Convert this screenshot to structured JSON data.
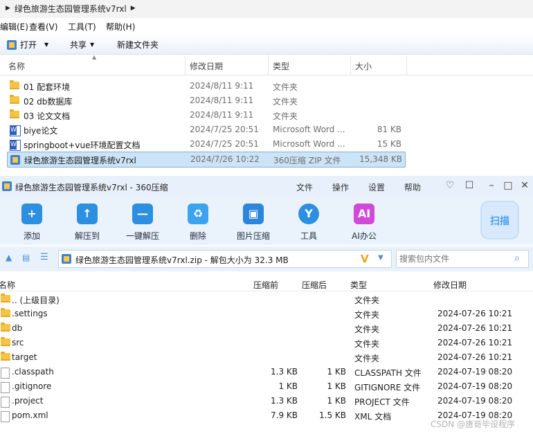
{
  "explorer": {
    "breadcrumb": "绿色旅游生态园管理系统v7rxl",
    "menu": [
      "编辑(E)",
      "查看(V)",
      "工具(T)",
      "帮助(H)"
    ],
    "toolbar": {
      "open": "打开",
      "share": "共享",
      "new_folder": "新建文件夹"
    },
    "columns": {
      "name": "名称",
      "date": "修改日期",
      "type": "类型",
      "size": "大小"
    },
    "rows": [
      {
        "icon": "folder-icon",
        "name": "01 配套环境",
        "date": "2024/8/11 9:11",
        "type": "文件夹",
        "size": ""
      },
      {
        "icon": "folder-icon",
        "name": "02 db数据库",
        "date": "2024/8/11 9:11",
        "type": "文件夹",
        "size": ""
      },
      {
        "icon": "folder-icon",
        "name": "03 论文文档",
        "date": "2024/8/11 9:11",
        "type": "文件夹",
        "size": ""
      },
      {
        "icon": "word-doc-icon",
        "name": "biye论文",
        "date": "2024/7/25 20:51",
        "type": "Microsoft Word ...",
        "size": "81 KB"
      },
      {
        "icon": "word-doc-icon",
        "name": "springboot+vue环境配置文档",
        "date": "2024/7/25 20:51",
        "type": "Microsoft Word ...",
        "size": "15 KB"
      },
      {
        "icon": "zip-icon",
        "name": "绿色旅游生态园管理系统v7rxl",
        "date": "2024/7/26 10:22",
        "type": "360压缩 ZIP 文件",
        "size": "15,348 KB"
      }
    ]
  },
  "zipwin": {
    "title": "绿色旅游生态园管理系统v7rxl - 360压缩",
    "menu": [
      "文件",
      "操作",
      "设置",
      "帮助"
    ],
    "ribbon": [
      "添加",
      "解压到",
      "一键解压",
      "删除",
      "图片压缩",
      "工具",
      "AI办公"
    ],
    "scan_label": "扫描",
    "path_text": "绿色旅游生态园管理系统v7rxl.zip - 解包大小为 32.3 MB",
    "search_placeholder": "搜索包内文件",
    "columns": {
      "name": "名称",
      "before": "压缩前",
      "after": "压缩后",
      "type": "类型",
      "date": "修改日期"
    },
    "rows": [
      {
        "icon": "folder-icon",
        "name": ".. (上级目录)",
        "before": "",
        "after": "",
        "type": "文件夹",
        "date": ""
      },
      {
        "icon": "folder-icon",
        "name": ".settings",
        "before": "",
        "after": "",
        "type": "文件夹",
        "date": "2024-07-26 10:21"
      },
      {
        "icon": "folder-icon",
        "name": "db",
        "before": "",
        "after": "",
        "type": "文件夹",
        "date": "2024-07-26 10:21"
      },
      {
        "icon": "folder-icon",
        "name": "src",
        "before": "",
        "after": "",
        "type": "文件夹",
        "date": "2024-07-26 10:21"
      },
      {
        "icon": "folder-icon",
        "name": "target",
        "before": "",
        "after": "",
        "type": "文件夹",
        "date": "2024-07-26 10:21"
      },
      {
        "icon": "file-icon",
        "name": ".classpath",
        "before": "1.3 KB",
        "after": "1 KB",
        "type": "CLASSPATH 文件",
        "date": "2024-07-19 08:20"
      },
      {
        "icon": "file-icon",
        "name": ".gitignore",
        "before": "1 KB",
        "after": "1 KB",
        "type": "GITIGNORE 文件",
        "date": "2024-07-19 08:20"
      },
      {
        "icon": "file-icon",
        "name": ".project",
        "before": "1.3 KB",
        "after": "1 KB",
        "type": "PROJECT 文件",
        "date": "2024-07-19 08:20"
      },
      {
        "icon": "xml-file-icon",
        "name": "pom.xml",
        "before": "7.9 KB",
        "after": "1.5 KB",
        "type": "XML 文档",
        "date": "2024-07-19 08:20"
      }
    ]
  },
  "watermark": "CSDN @唐哥毕设程序"
}
